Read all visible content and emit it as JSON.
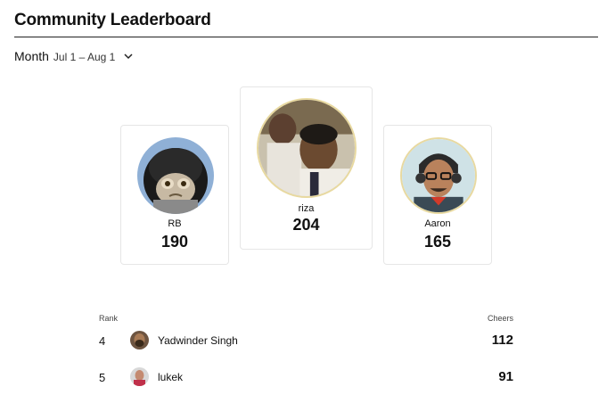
{
  "page": {
    "title": "Community Leaderboard"
  },
  "period": {
    "label": "Month",
    "range": "Jul 1 – Aug 1"
  },
  "podium": {
    "second": {
      "name": "RB",
      "score": "190"
    },
    "first": {
      "name": "riza",
      "score": "204"
    },
    "third": {
      "name": "Aaron",
      "score": "165"
    }
  },
  "table": {
    "rank_header": "Rank",
    "cheers_header": "Cheers",
    "rows": [
      {
        "rank": "4",
        "name": "Yadwinder Singh",
        "cheers": "112"
      },
      {
        "rank": "5",
        "name": "lukek",
        "cheers": "91"
      }
    ]
  },
  "colors": {
    "accent_ring": "#e8d9a0",
    "divider": "#222222",
    "card_border": "#e6e6e6"
  }
}
